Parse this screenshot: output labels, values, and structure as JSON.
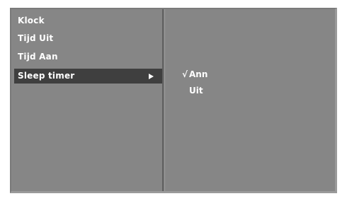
{
  "menu": {
    "items": [
      {
        "label": "Klock"
      },
      {
        "label": "Tijd Uit"
      },
      {
        "label": "Tijd Aan"
      },
      {
        "label": "Sleep timer"
      }
    ],
    "selected_index": 3
  },
  "submenu": {
    "options": [
      {
        "label": "Ann",
        "checked": true
      },
      {
        "label": "Uit",
        "checked": false
      }
    ],
    "check_glyph": "√"
  },
  "colors": {
    "panel": "#868686",
    "highlight": "#3f3f3f",
    "text": "#ffffff"
  }
}
